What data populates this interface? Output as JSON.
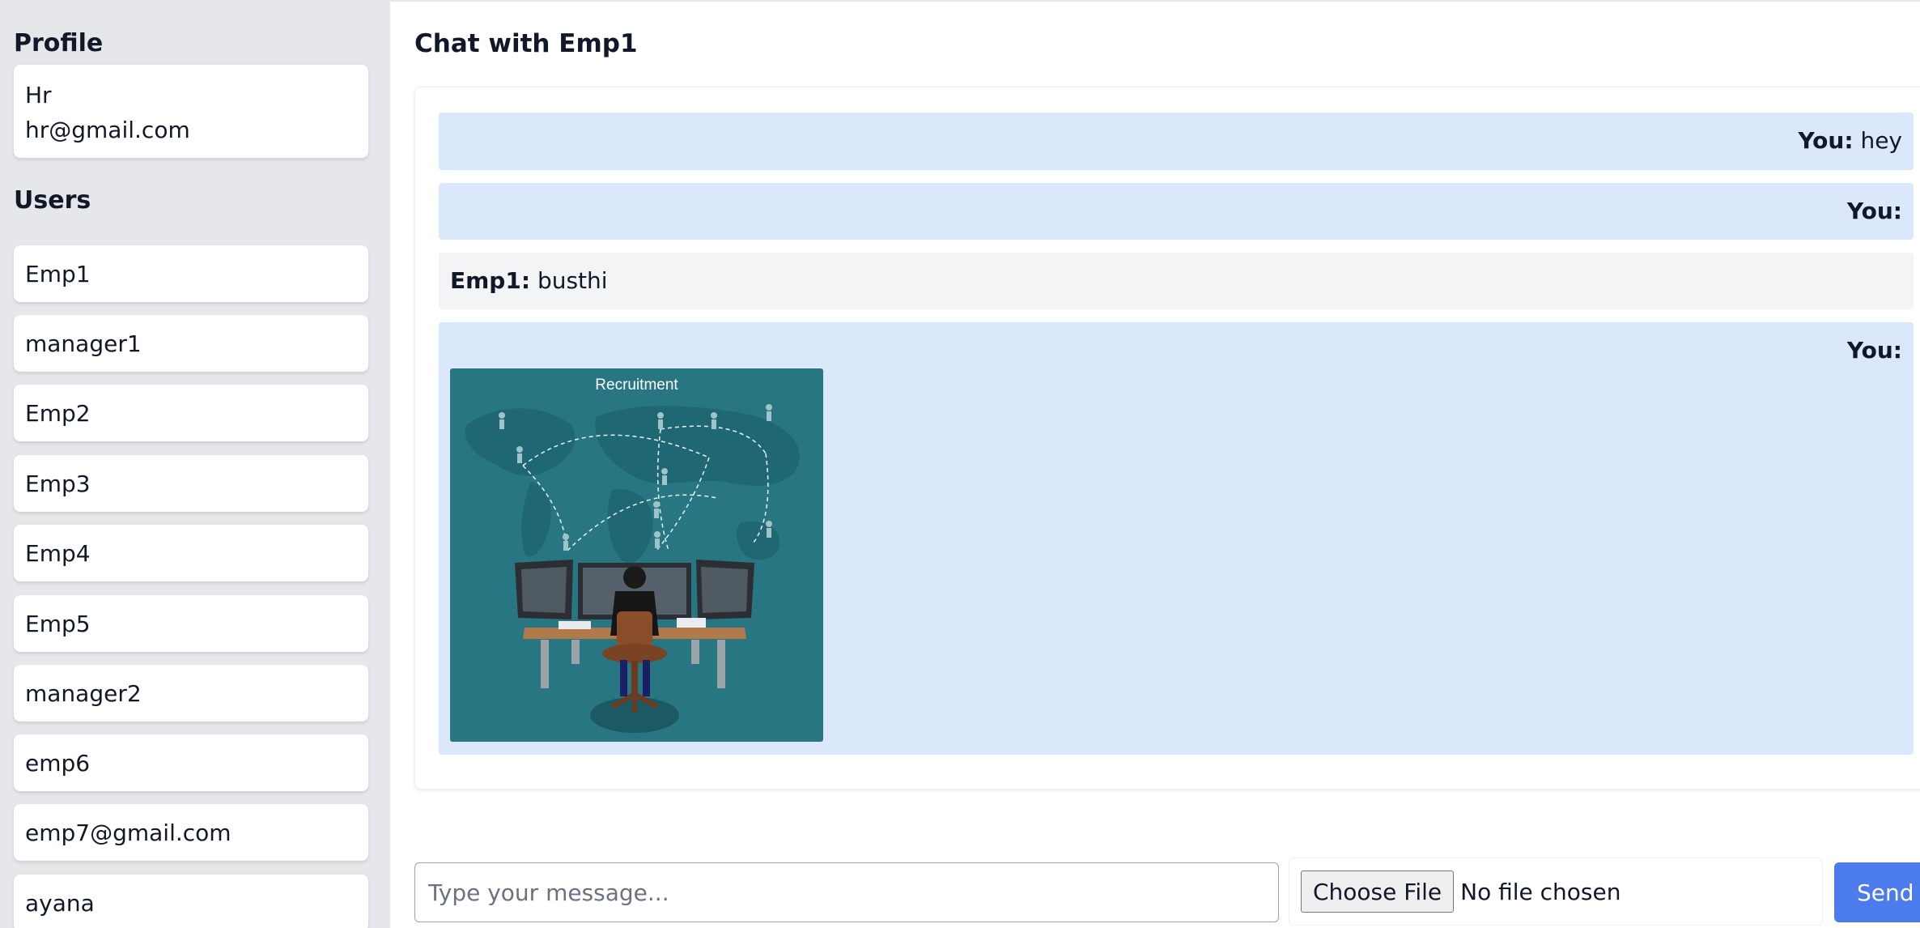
{
  "sidebar": {
    "profile_heading": "Profile",
    "profile": {
      "name": "Hr",
      "email": "hr@gmail.com"
    },
    "users_heading": "Users",
    "users": [
      {
        "label": "Emp1"
      },
      {
        "label": "manager1"
      },
      {
        "label": "Emp2"
      },
      {
        "label": "Emp3"
      },
      {
        "label": "Emp4"
      },
      {
        "label": "Emp5"
      },
      {
        "label": "manager2"
      },
      {
        "label": "emp6"
      },
      {
        "label": "emp7@gmail.com"
      },
      {
        "label": "ayana"
      }
    ]
  },
  "chat": {
    "title": "Chat with Emp1",
    "messages": [
      {
        "sender": "You:",
        "text": "hey"
      },
      {
        "sender": "You:",
        "text": ""
      },
      {
        "sender": "Emp1:",
        "text": "busthi"
      },
      {
        "sender": "You:",
        "text": "",
        "image_title": "Recruitment"
      }
    ]
  },
  "composer": {
    "placeholder": "Type your message...",
    "choose_file_label": "Choose File",
    "file_status": "No file chosen",
    "send_label": "Send"
  },
  "colors": {
    "sidebar_bg": "#e5e7eb",
    "own_message_bg": "#dbe7fa",
    "other_message_bg": "#f3f4f6",
    "send_button": "#4b7bec",
    "image_bg": "#287682"
  }
}
